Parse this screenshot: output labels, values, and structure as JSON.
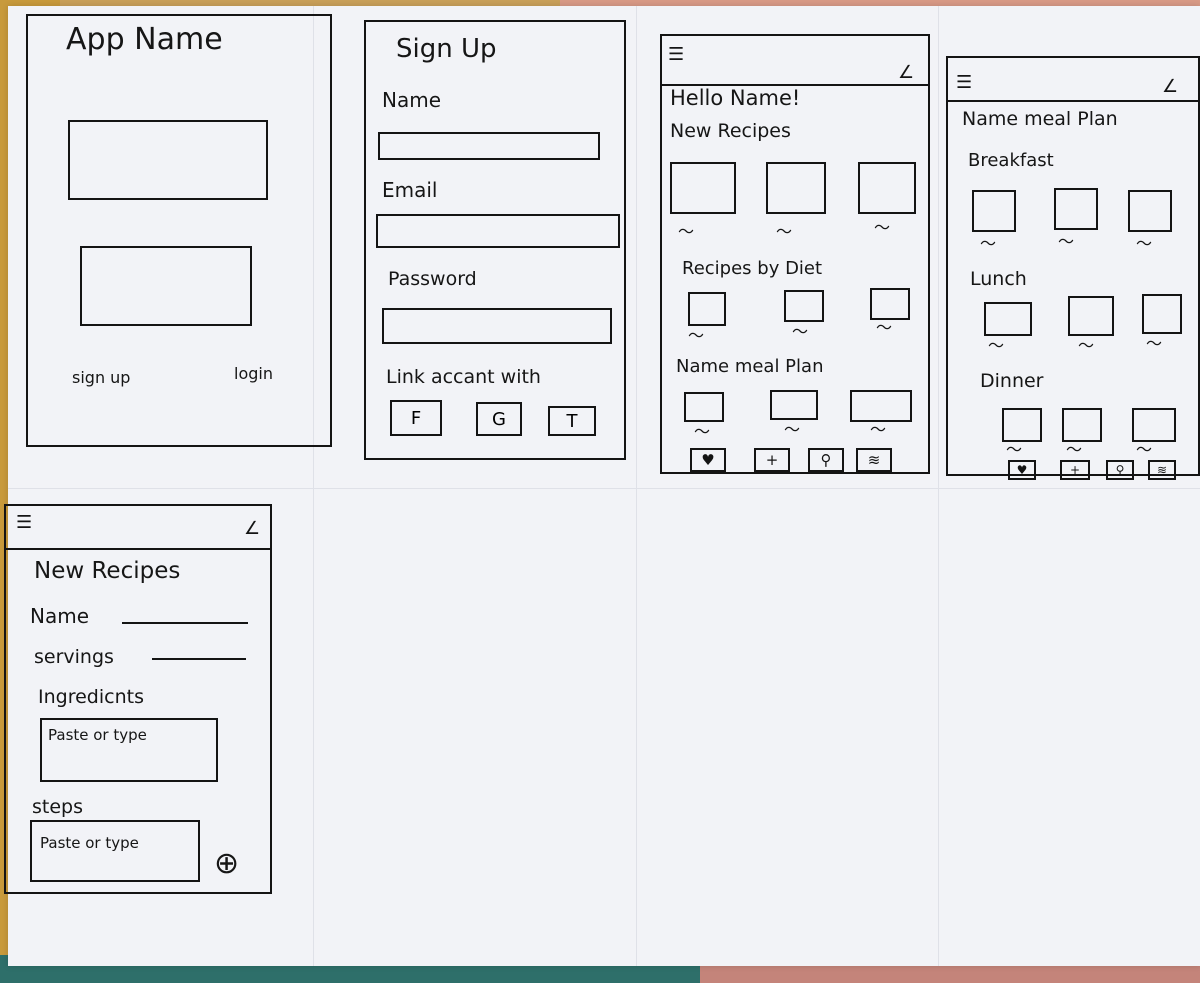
{
  "screen1": {
    "title": "App Name",
    "signup": "sign up",
    "login": "login"
  },
  "screen2": {
    "title": "Sign Up",
    "name_label": "Name",
    "email_label": "Email",
    "password_label": "Password",
    "link_label": "Link accant with",
    "social": [
      "F",
      "G",
      "T"
    ]
  },
  "screen3": {
    "greeting": "Hello Name!",
    "section1": "New Recipes",
    "section2": "Recipes by Diet",
    "section3": "Name meal Plan"
  },
  "screen4": {
    "title": "Name meal Plan",
    "breakfast": "Breakfast",
    "lunch": "Lunch",
    "dinner": "Dinner"
  },
  "screen5": {
    "title": "New Recipes",
    "name_label": "Name",
    "servings_label": "servings",
    "ingredients_label": "Ingredicnts",
    "ingredients_placeholder": "Paste or type",
    "steps_label": "steps",
    "steps_placeholder": "Paste or type"
  },
  "icons": {
    "menu": "☰",
    "back": "∠",
    "heart": "♥",
    "plus": "+",
    "search": "⚲",
    "list": "≋",
    "add_circle": "⊕",
    "squiggle": "〜"
  }
}
